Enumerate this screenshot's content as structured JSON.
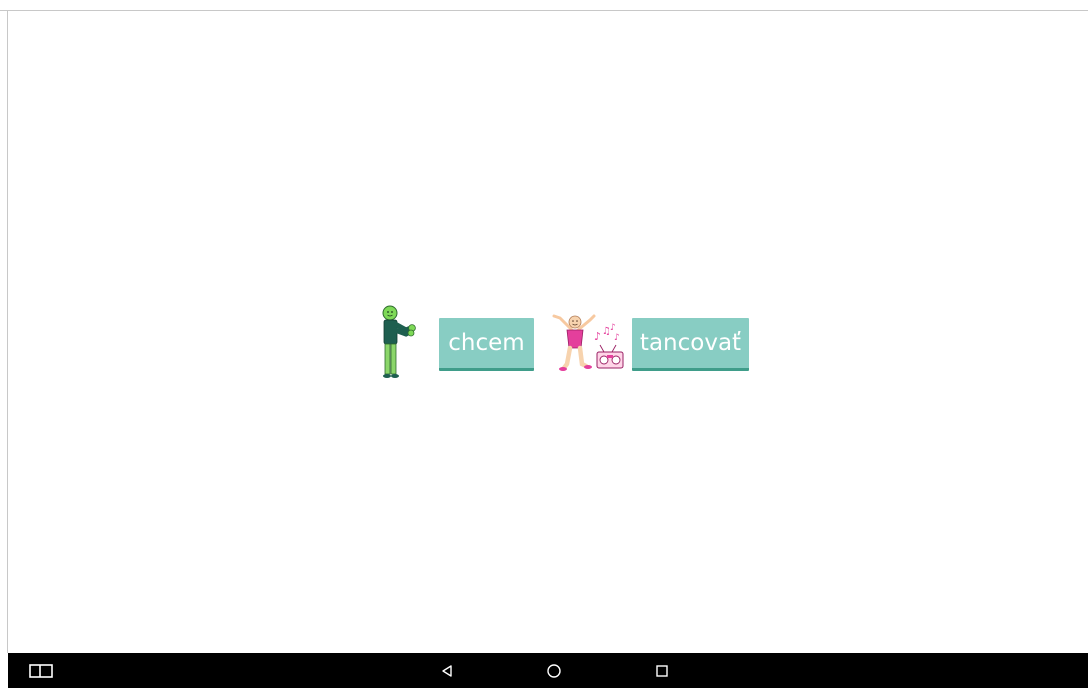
{
  "sentence": {
    "words": [
      {
        "symbol": "person-wanting-symbol",
        "label": "chcem"
      },
      {
        "symbol": "person-dancing-symbol",
        "label": "tancovať"
      }
    ]
  },
  "navbar": {
    "buttons": [
      "keyboard-toggle",
      "back",
      "home",
      "recents"
    ]
  },
  "colors": {
    "card": "#88cdc3",
    "card_border": "#3f9d8a",
    "navbar": "#000000",
    "background": "#ffffff"
  }
}
